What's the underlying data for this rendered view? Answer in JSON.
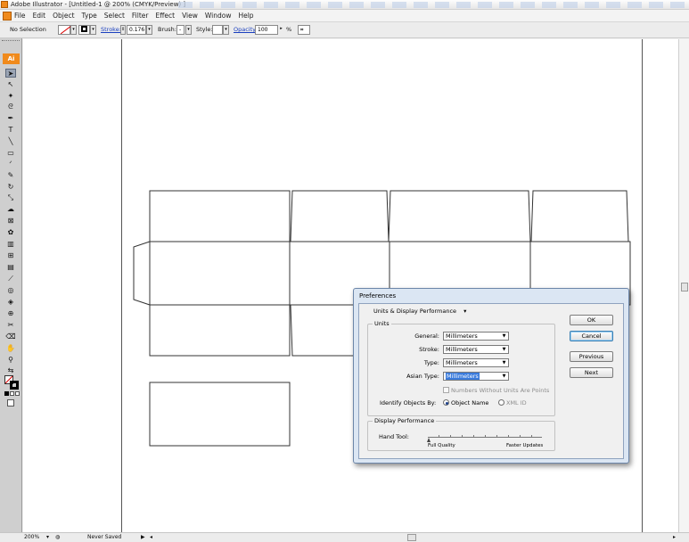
{
  "window": {
    "title": "Adobe Illustrator - [Untitled-1 @ 200% (CMYK/Preview) ]"
  },
  "menu": [
    "File",
    "Edit",
    "Object",
    "Type",
    "Select",
    "Filter",
    "Effect",
    "View",
    "Window",
    "Help"
  ],
  "control_bar": {
    "selection": "No Selection",
    "stroke_label": "Stroke:",
    "stroke_value": "0.176",
    "brush_label": "Brush:",
    "style_label": "Style:",
    "opacity_label": "Opacity:",
    "opacity_value": "100",
    "opacity_unit": "%"
  },
  "tools": {
    "logo": "Ai",
    "items": [
      "selection-tool",
      "direct-selection-tool",
      "magic-wand-tool",
      "lasso-tool",
      "pen-tool",
      "type-tool",
      "line-segment-tool",
      "rectangle-tool",
      "paintbrush-tool",
      "pencil-tool",
      "rotate-tool",
      "scale-tool",
      "warp-tool",
      "free-transform-tool",
      "symbol-sprayer-tool",
      "column-graph-tool",
      "mesh-tool",
      "gradient-tool",
      "eyedropper-tool",
      "blend-tool",
      "live-paint-bucket-tool",
      "live-paint-selection-tool",
      "slice-tool",
      "eraser-tool",
      "hand-tool",
      "zoom-tool"
    ]
  },
  "status_bar": {
    "zoom": "200%",
    "save_state": "Never Saved"
  },
  "dialog": {
    "title": "Preferences",
    "section": "Units & Display Performance",
    "units_legend": "Units",
    "general_label": "General:",
    "general_value": "Millimeters",
    "stroke_label": "Stroke:",
    "stroke_value": "Millimeters",
    "type_label": "Type:",
    "type_value": "Millimeters",
    "asian_type_label": "Asian Type:",
    "asian_type_value": "Millimeters",
    "numbers_without_units": "Numbers Without Units Are Points",
    "identify_label": "Identify Objects By:",
    "object_name": "Object Name",
    "xml_id": "XML ID",
    "display_legend": "Display Performance",
    "hand_tool_label": "Hand Tool:",
    "full_quality": "Full Quality",
    "faster_updates": "Faster Updates",
    "ok": "OK",
    "cancel": "Cancel",
    "previous": "Previous",
    "next": "Next"
  }
}
